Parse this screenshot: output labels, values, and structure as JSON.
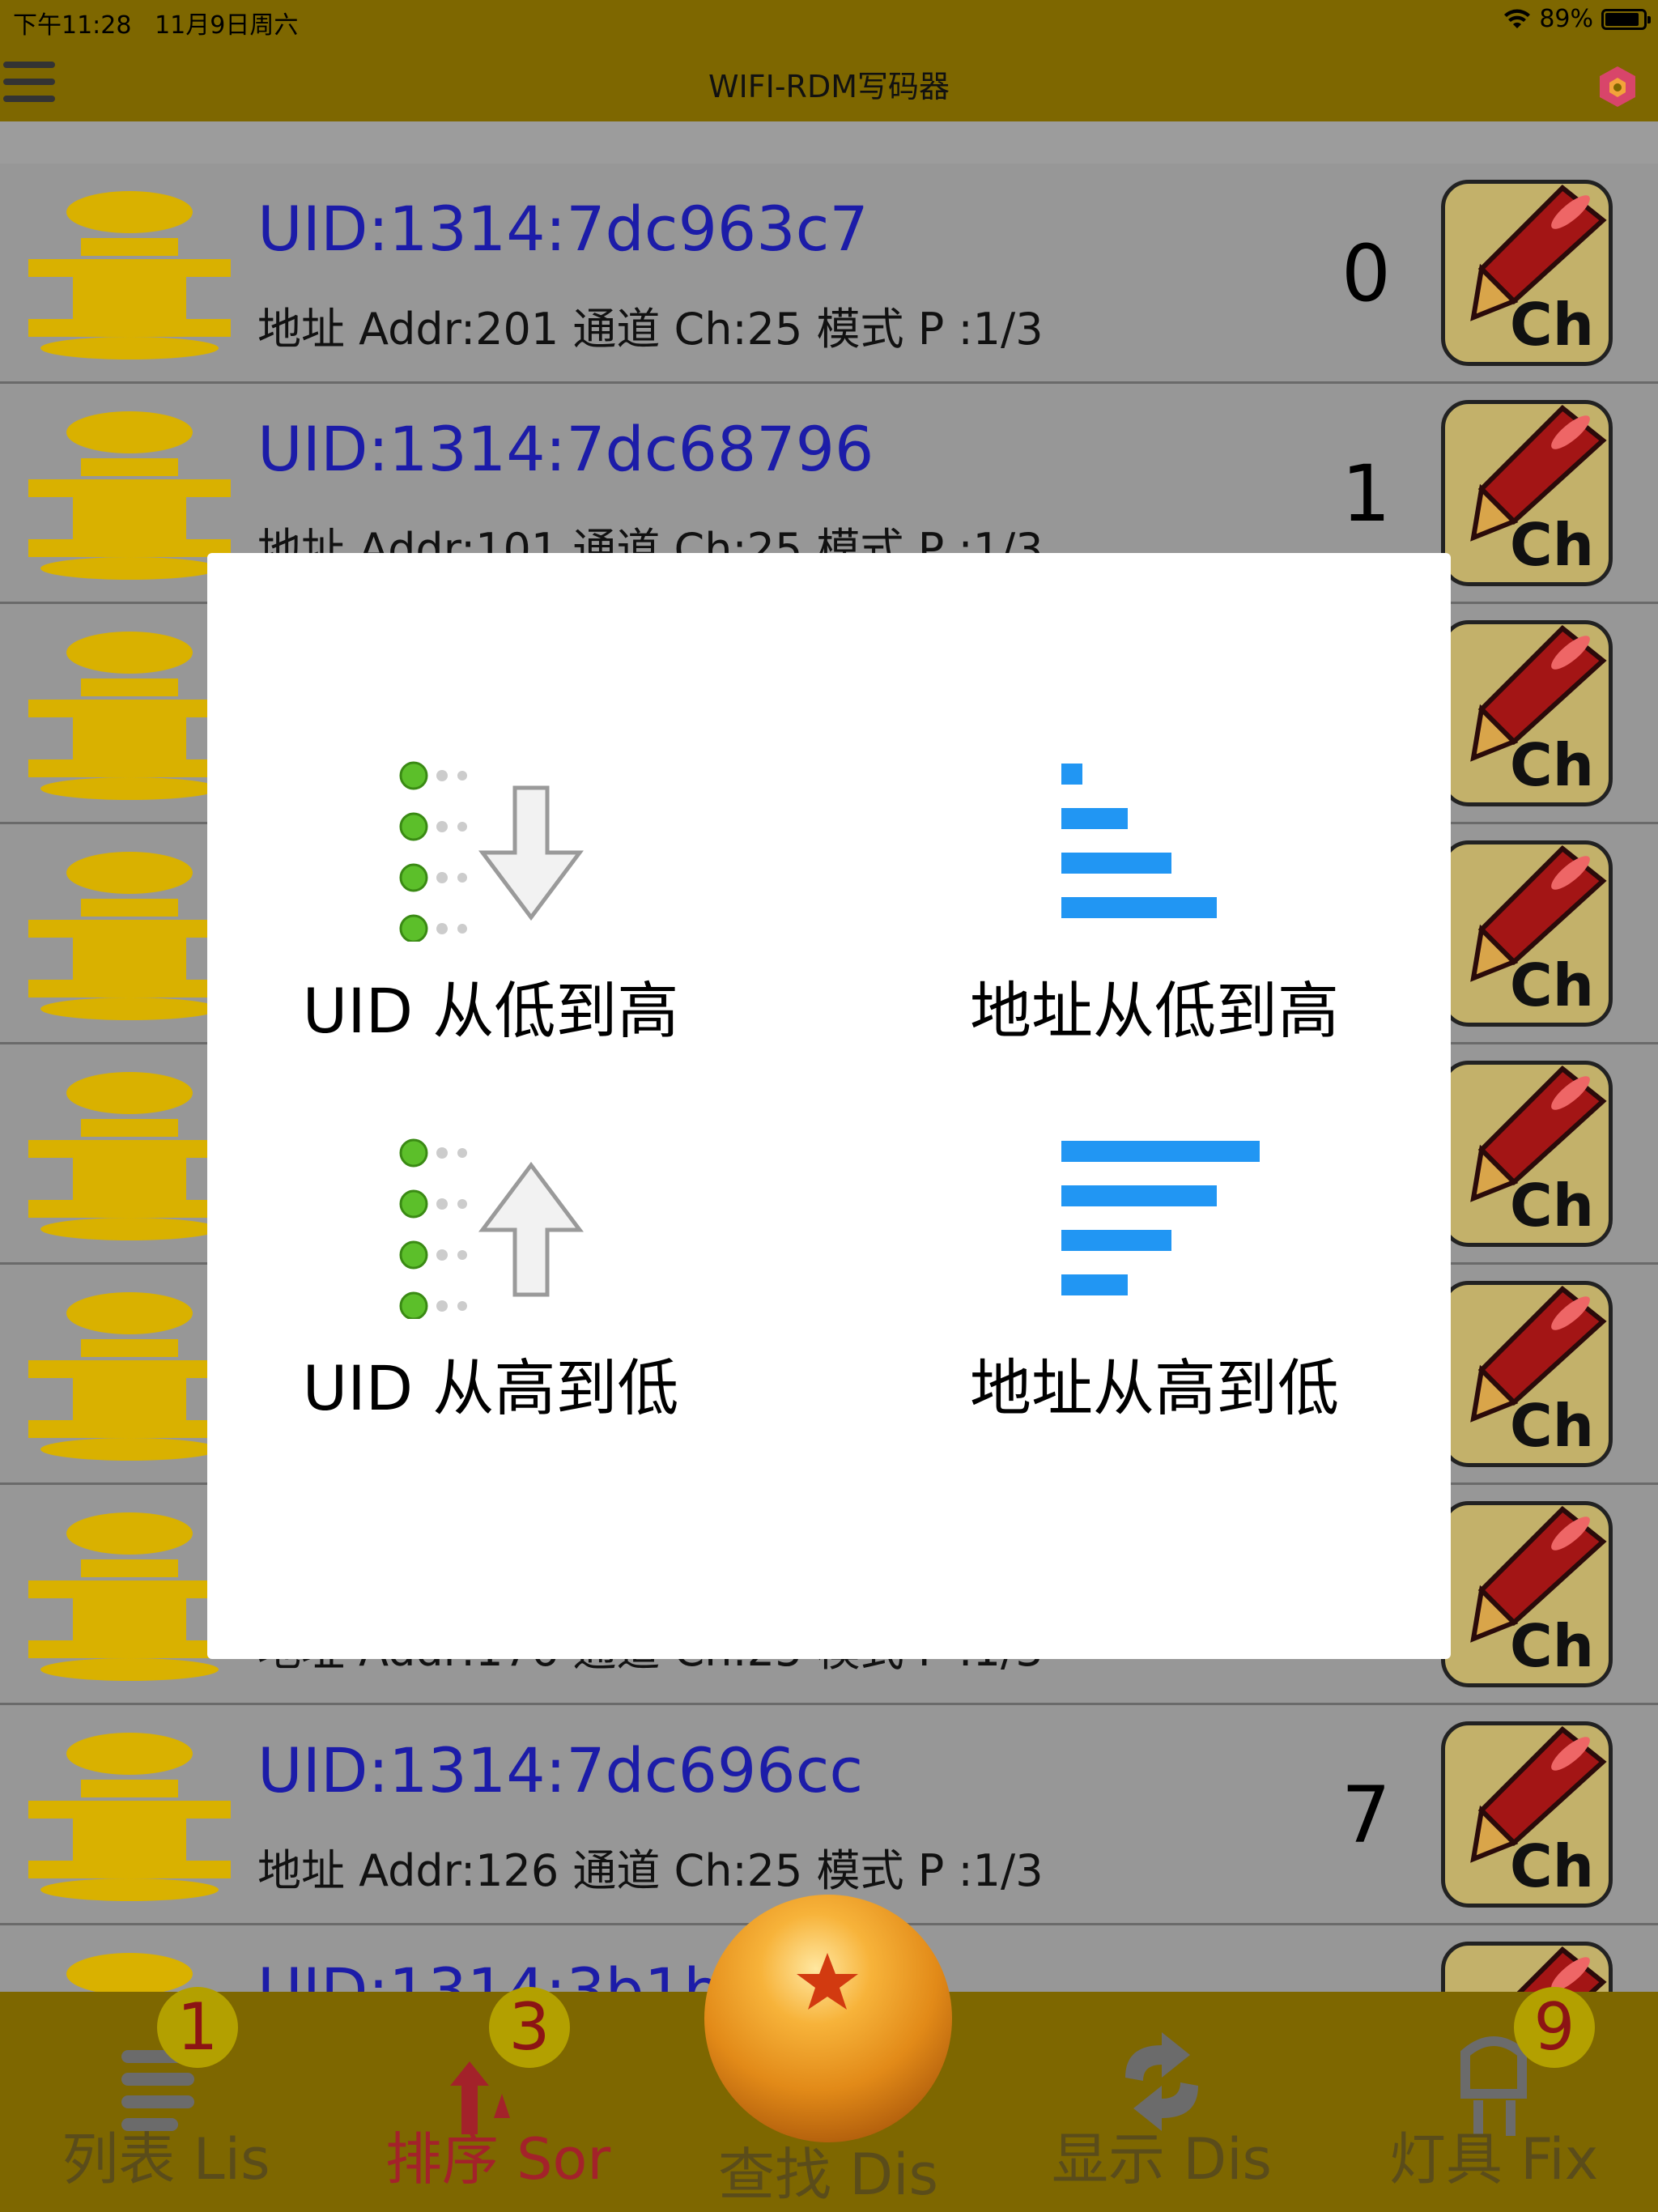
{
  "status_bar": {
    "time": "下午11:28",
    "date": "11月9日周六",
    "battery": "89%",
    "battery_level": 0.89
  },
  "nav": {
    "title": "WIFI-RDM写码器",
    "menu_icon": "hamburger-icon",
    "logo_icon": "hexagon-logo-icon"
  },
  "fixtures": [
    {
      "uid": "UID:1314:7dc963c7",
      "info": "地址 Addr:201  通道 Ch:25  模式 P :1/3",
      "index": "0",
      "button": "Ch"
    },
    {
      "uid": "UID:1314:7dc68796",
      "info": "地址 Addr:101  通道 Ch:25  模式 P :1/3",
      "index": "1",
      "button": "Ch"
    },
    {
      "uid": "",
      "info": "",
      "index": "",
      "button": "Ch"
    },
    {
      "uid": "",
      "info": "",
      "index": "",
      "button": "Ch"
    },
    {
      "uid": "",
      "info": "",
      "index": "",
      "button": "Ch"
    },
    {
      "uid": "",
      "info": "",
      "index": "",
      "button": "Ch"
    },
    {
      "uid": "",
      "info": "地址 Addr:176  通道 Ch:25  模式 P :1/3",
      "index": "",
      "button": "Ch"
    },
    {
      "uid": "UID:1314:7dc696cc",
      "info": "地址 Addr:126  通道 Ch:25  模式 P :1/3",
      "index": "7",
      "button": "Ch"
    },
    {
      "uid": "UID:1314:3b1b5",
      "info": "",
      "index": "",
      "button": "Ch"
    }
  ],
  "sort_dialog": {
    "uid_asc": "UID 从低到高",
    "addr_asc": "地址从低到高",
    "uid_desc": "UID 从高到低",
    "addr_desc": "地址从高到低",
    "colors": {
      "bars": "#2196f3",
      "dots": "#5cbf2a"
    }
  },
  "tabbar": {
    "list": {
      "label": "列表 Lis",
      "badge": "1"
    },
    "sort": {
      "label": "排序 Sor",
      "badge": "3"
    },
    "discover": {
      "label": "查找 Dis"
    },
    "display": {
      "label": "显示 Dis"
    },
    "fixture": {
      "label": "灯具 Fix",
      "badge": "9"
    }
  }
}
